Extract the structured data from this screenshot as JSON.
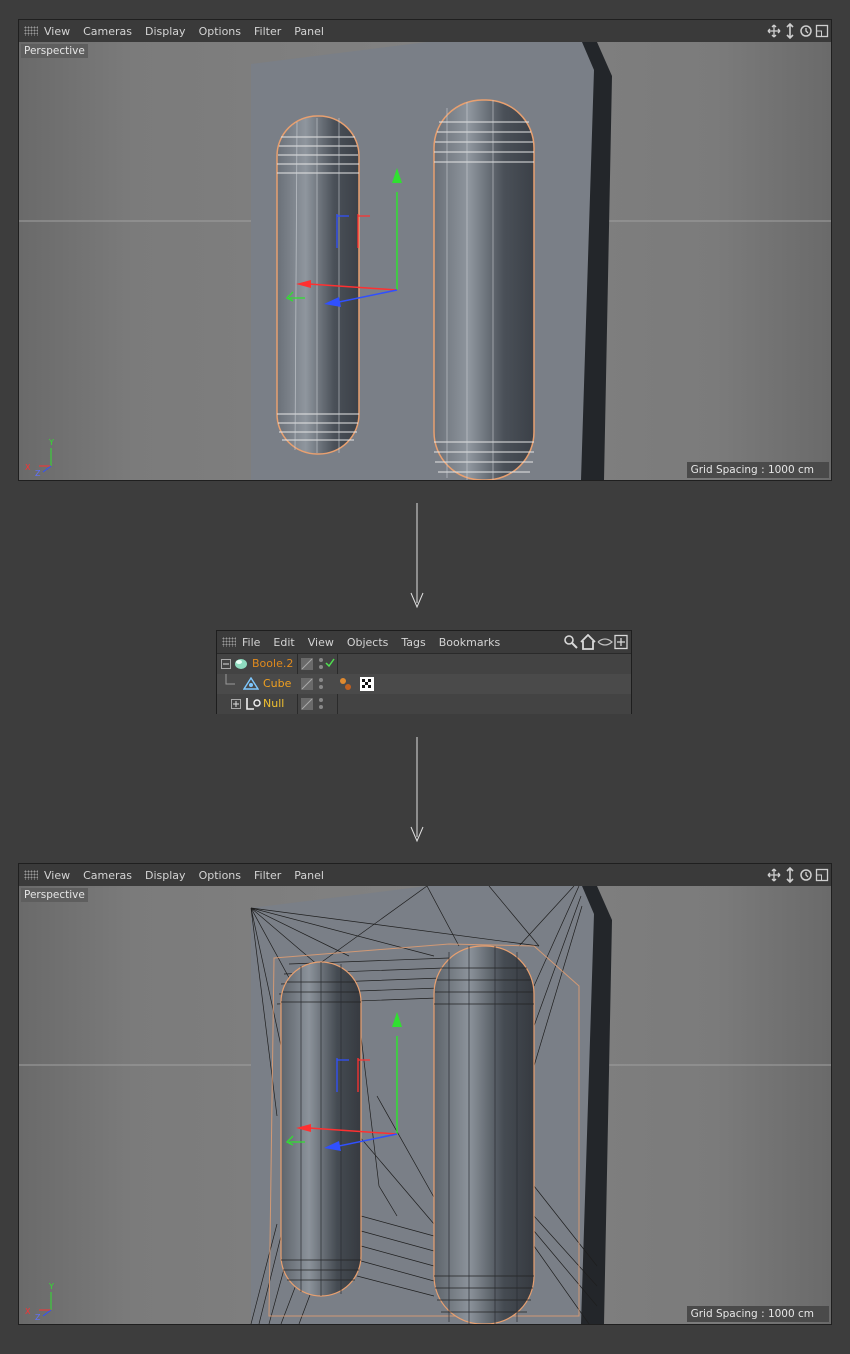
{
  "viewport_menu": [
    "View",
    "Cameras",
    "Display",
    "Options",
    "Filter",
    "Panel"
  ],
  "top_viewport": {
    "label": "Perspective",
    "grid_spacing": "Grid Spacing : 1000 cm"
  },
  "bottom_viewport": {
    "label": "Perspective",
    "grid_spacing": "Grid Spacing : 1000 cm"
  },
  "object_manager": {
    "menu": [
      "File",
      "Edit",
      "View",
      "Objects",
      "Tags",
      "Bookmarks"
    ],
    "objects": [
      {
        "name": "Boole.2",
        "icon": "boole-icon",
        "color": "#e08a1e"
      },
      {
        "name": "Cube",
        "icon": "cube-icon",
        "color": "#f0a020"
      },
      {
        "name": "Null",
        "icon": "null-icon",
        "color": "#f0c030"
      }
    ]
  },
  "colors": {
    "background": "#3d3d3d",
    "selection": "#e8a060",
    "axis_x": "#ff3030",
    "axis_y": "#30e030",
    "axis_z": "#3050ff"
  }
}
